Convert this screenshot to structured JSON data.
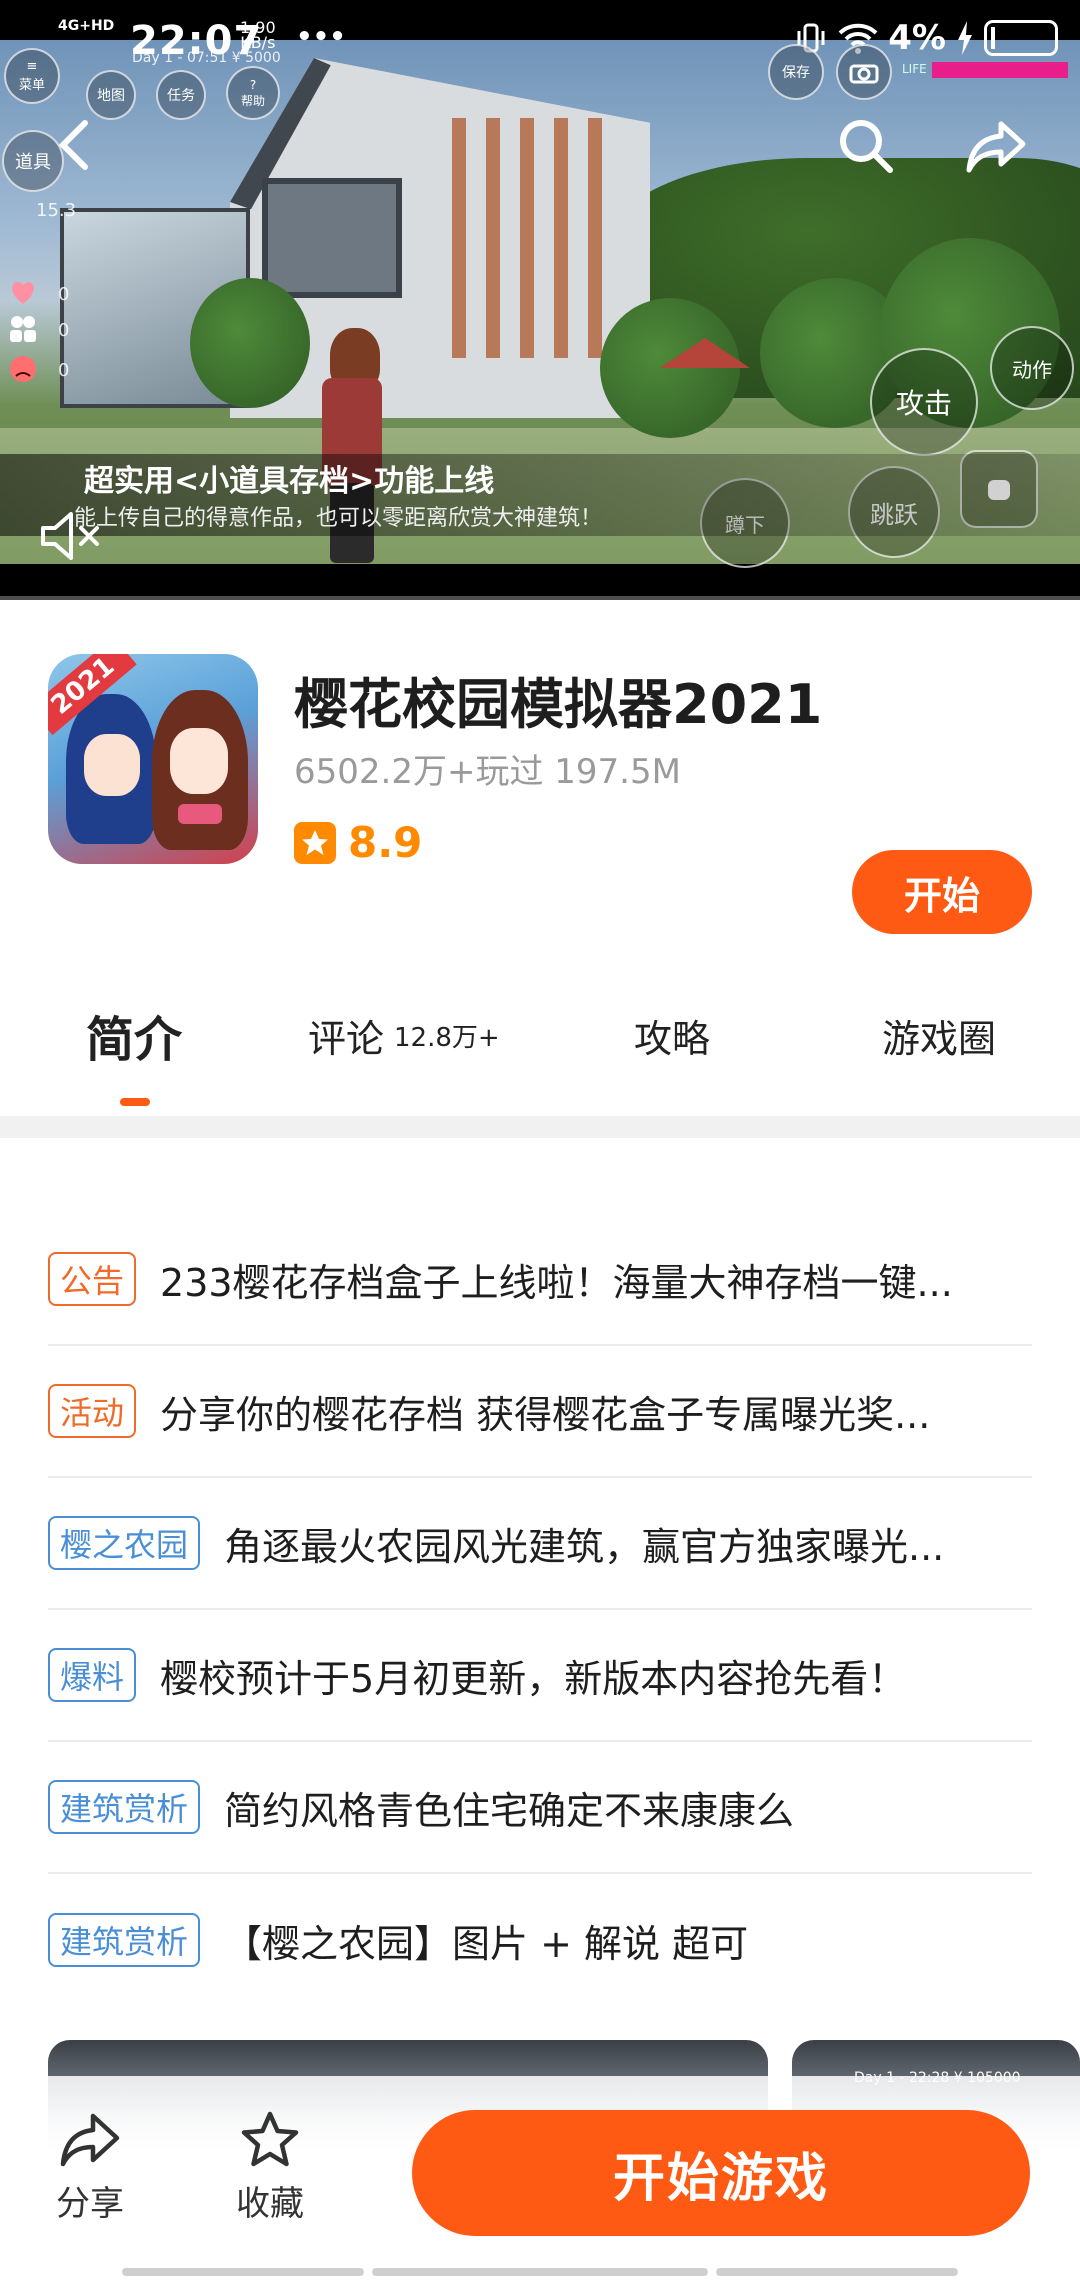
{
  "status_bar": {
    "network": "4G+HD",
    "time": "22:07",
    "speed_value": "1.90",
    "speed_unit": "KB/s",
    "more": "•••",
    "battery": "4%"
  },
  "game_hud": {
    "menu": "菜单",
    "map": "地图",
    "task": "任务",
    "help": "帮助",
    "props": "道具",
    "save": "保存",
    "day_money": "Day 1 - 07:51  ¥ 5000",
    "stat_a": "15.3",
    "stat_heart": "0",
    "stat_friends": "0",
    "stat_anger": "0",
    "attack": "攻击",
    "action": "动作",
    "jump": "跳跃",
    "crouch": "蹲下",
    "life_label": "LIFE"
  },
  "video": {
    "banner_title": "超实用<小道具存档>功能上线",
    "banner_subtitle": "能上传自己的得意作品，也可以零距离欣赏大神建筑！",
    "progress": 0.0
  },
  "app": {
    "name": "樱花校园模拟器2021",
    "meta": "6502.2万+玩过  197.5M",
    "rating": "8.9",
    "icon_badge": "2021",
    "start_label": "开始"
  },
  "tabs": [
    {
      "label": "简介",
      "count": ""
    },
    {
      "label": "评论",
      "count": "12.8万+"
    },
    {
      "label": "攻略",
      "count": ""
    },
    {
      "label": "游戏圈",
      "count": ""
    }
  ],
  "posts": [
    {
      "tag": "公告",
      "tag_color": "orange",
      "title": "233樱花存档盒子上线啦！海量大神存档一键..."
    },
    {
      "tag": "活动",
      "tag_color": "orange",
      "title": "分享你的樱花存档 获得樱花盒子专属曝光奖..."
    },
    {
      "tag": "樱之农园",
      "tag_color": "blue",
      "title": "角逐最火农园风光建筑，赢官方独家曝光..."
    },
    {
      "tag": "爆料",
      "tag_color": "blue",
      "title": "樱校预计于5月初更新，新版本内容抢先看！"
    },
    {
      "tag": "建筑赏析",
      "tag_color": "blue",
      "title": "简约风格青色住宅确定不来康康么"
    },
    {
      "tag": "建筑赏析",
      "tag_color": "blue",
      "title": "【樱之农园】图片 + 解说 超可"
    }
  ],
  "thumbnails": [
    {
      "caption": ""
    },
    {
      "caption": "Day 1 - 22:28  ¥ 105000"
    }
  ],
  "bottom_bar": {
    "share_label": "分享",
    "favorite_label": "收藏",
    "play_label": "开始游戏"
  },
  "colors": {
    "accent": "#ff5a14",
    "rating": "#ff8a00",
    "tag_orange": "#f06a2a",
    "tag_blue": "#4a8fd6"
  },
  "icons": {
    "back": "back-arrow-icon",
    "search": "search-icon",
    "share": "share-icon",
    "mute": "mute-icon",
    "star": "star-icon"
  }
}
